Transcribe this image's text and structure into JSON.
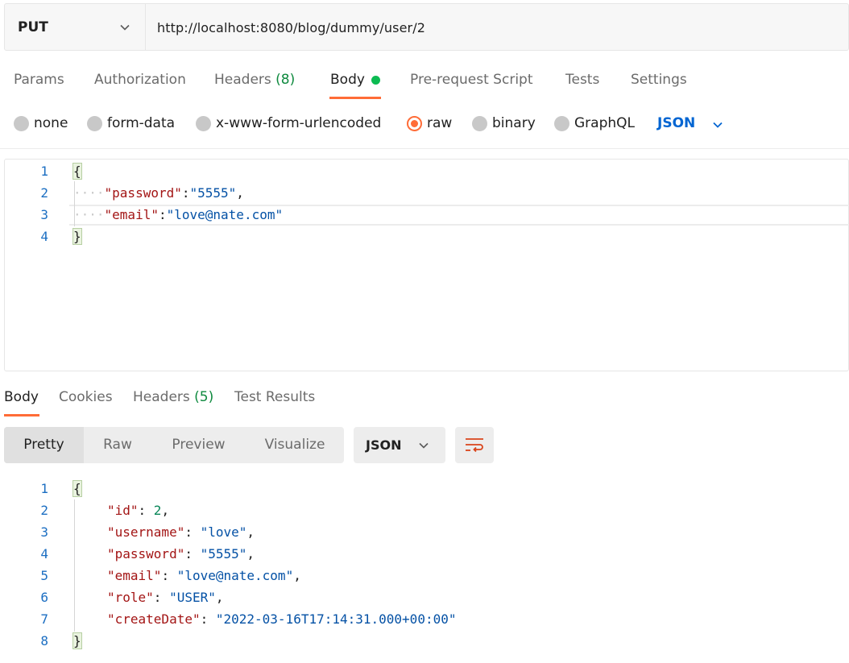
{
  "request": {
    "method": "PUT",
    "url": "http://localhost:8080/blog/dummy/user/2"
  },
  "request_tabs": [
    {
      "label": "Params"
    },
    {
      "label": "Authorization"
    },
    {
      "label": "Headers",
      "count": "(8)"
    },
    {
      "label": "Body"
    },
    {
      "label": "Pre-request Script"
    },
    {
      "label": "Tests"
    },
    {
      "label": "Settings"
    }
  ],
  "body_types": [
    {
      "label": "none"
    },
    {
      "label": "form-data"
    },
    {
      "label": "x-www-form-urlencoded"
    },
    {
      "label": "raw"
    },
    {
      "label": "binary"
    },
    {
      "label": "GraphQL"
    }
  ],
  "body_language": "JSON",
  "request_body": {
    "line_numbers": [
      "1",
      "2",
      "3",
      "4"
    ],
    "open_brace": "{",
    "close_brace": "}",
    "indent_dots": "····",
    "lines": [
      {
        "key": "\"password\"",
        "punct": ":",
        "value": "\"5555\"",
        "trail": ","
      },
      {
        "key": "\"email\"",
        "punct": ":",
        "value": "\"love@nate.com\"",
        "trail": ""
      }
    ]
  },
  "response_tabs": [
    {
      "label": "Body"
    },
    {
      "label": "Cookies"
    },
    {
      "label": "Headers",
      "count": "(5)"
    },
    {
      "label": "Test Results"
    }
  ],
  "view_modes": [
    {
      "label": "Pretty"
    },
    {
      "label": "Raw"
    },
    {
      "label": "Preview"
    },
    {
      "label": "Visualize"
    }
  ],
  "response_format": "JSON",
  "response_body": {
    "line_numbers": [
      "1",
      "2",
      "3",
      "4",
      "5",
      "6",
      "7",
      "8"
    ],
    "open_brace": "{",
    "close_brace": "}",
    "lines": [
      {
        "key": "\"id\"",
        "punct": ": ",
        "value": "2",
        "trail": ",",
        "type": "num"
      },
      {
        "key": "\"username\"",
        "punct": ": ",
        "value": "\"love\"",
        "trail": ",",
        "type": "str"
      },
      {
        "key": "\"password\"",
        "punct": ": ",
        "value": "\"5555\"",
        "trail": ",",
        "type": "str"
      },
      {
        "key": "\"email\"",
        "punct": ": ",
        "value": "\"love@nate.com\"",
        "trail": ",",
        "type": "str"
      },
      {
        "key": "\"role\"",
        "punct": ": ",
        "value": "\"USER\"",
        "trail": ",",
        "type": "str"
      },
      {
        "key": "\"createDate\"",
        "punct": ": ",
        "value": "\"2022-03-16T17:14:31.000+00:00\"",
        "trail": "",
        "type": "str"
      }
    ]
  },
  "colors": {
    "accent": "#ff6c37",
    "active_dot": "#0cbb52",
    "link_blue": "#0265d2",
    "json_key": "#a31515",
    "json_string": "#0451a5",
    "json_number": "#098658"
  }
}
